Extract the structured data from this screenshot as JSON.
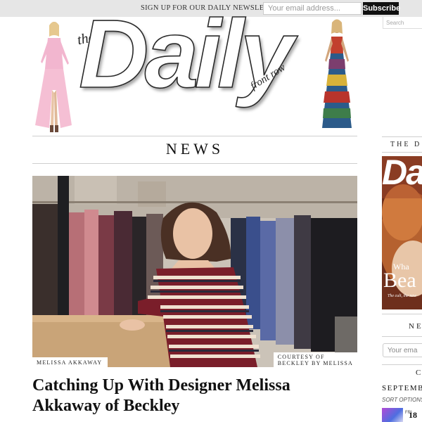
{
  "newsletter": {
    "label": "SIGN UP FOR OUR DAILY NEWSLETTER",
    "placeholder": "Your email address...",
    "button": "Subscribe"
  },
  "search": {
    "placeholder": "Search"
  },
  "logo": {
    "the": "the",
    "daily": "Daily",
    "frontrow": "front row"
  },
  "section": {
    "title": "NEWS"
  },
  "hero": {
    "caption_left": "MELISSA AKKAWAY",
    "caption_right_line1": "COURTESY OF",
    "caption_right_line2": "BECKLEY BY MELISSA"
  },
  "article": {
    "headline_line1": "Catching Up With Designer Melissa",
    "headline_line2": "Akkaway of Beckley"
  },
  "sidebar": {
    "daily_title": "THE D",
    "cover_word1": "Da",
    "cover_word2": "Wha",
    "cover_word3": "Bea",
    "cover_tag": "The cult, the new",
    "newsletter_title": "NE",
    "email_placeholder": "Your ema",
    "calendar_title": "C",
    "month": "SEPTEMB",
    "sort_options": "SORT OPTIONS",
    "day_label": "FRI",
    "date": "18"
  },
  "colors": {
    "topbar": "#e6e6e6",
    "button": "#111111",
    "rule": "#cfcfcf"
  }
}
